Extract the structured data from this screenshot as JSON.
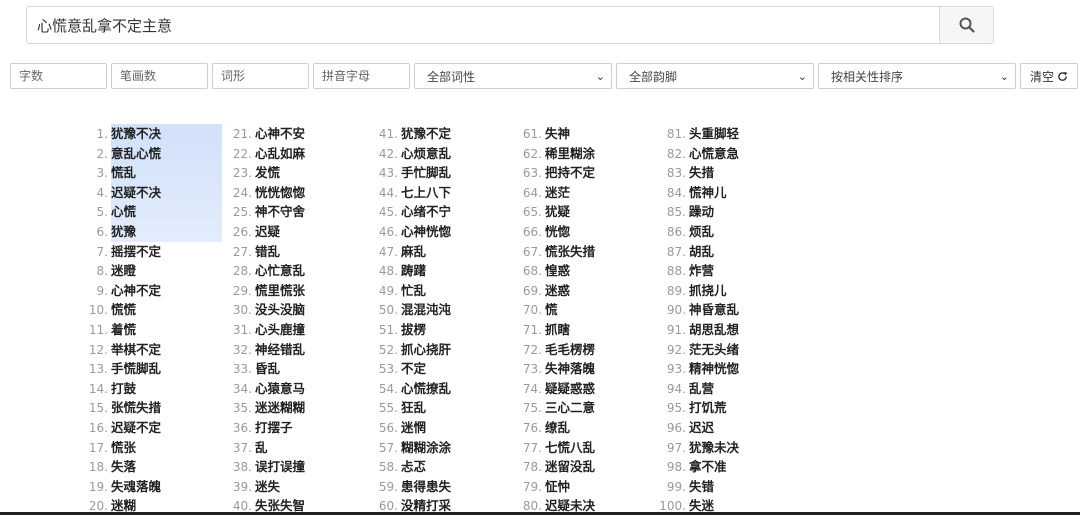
{
  "search": {
    "value": "心慌意乱拿不定主意"
  },
  "filters": {
    "char_count_placeholder": "字数",
    "stroke_count_placeholder": "笔画数",
    "word_form_placeholder": "词形",
    "pinyin_placeholder": "拼音字母",
    "part_of_speech": "全部词性",
    "rhyme": "全部韵脚",
    "sort": "按相关性排序",
    "clear_label": "清空"
  },
  "results": [
    {
      "n": "1.",
      "w": "犹豫不决"
    },
    {
      "n": "2.",
      "w": "意乱心慌"
    },
    {
      "n": "3.",
      "w": "慌乱"
    },
    {
      "n": "4.",
      "w": "迟疑不决"
    },
    {
      "n": "5.",
      "w": "心慌"
    },
    {
      "n": "6.",
      "w": "犹豫"
    },
    {
      "n": "7.",
      "w": "摇摆不定"
    },
    {
      "n": "8.",
      "w": "迷瞪"
    },
    {
      "n": "9.",
      "w": "心神不定"
    },
    {
      "n": "10.",
      "w": "慌慌"
    },
    {
      "n": "11.",
      "w": "着慌"
    },
    {
      "n": "12.",
      "w": "举棋不定"
    },
    {
      "n": "13.",
      "w": "手慌脚乱"
    },
    {
      "n": "14.",
      "w": "打鼓"
    },
    {
      "n": "15.",
      "w": "张慌失措"
    },
    {
      "n": "16.",
      "w": "迟疑不定"
    },
    {
      "n": "17.",
      "w": "慌张"
    },
    {
      "n": "18.",
      "w": "失落"
    },
    {
      "n": "19.",
      "w": "失魂落魄"
    },
    {
      "n": "20.",
      "w": "迷糊"
    },
    {
      "n": "21.",
      "w": "心神不安"
    },
    {
      "n": "22.",
      "w": "心乱如麻"
    },
    {
      "n": "23.",
      "w": "发慌"
    },
    {
      "n": "24.",
      "w": "恍恍惚惚"
    },
    {
      "n": "25.",
      "w": "神不守舍"
    },
    {
      "n": "26.",
      "w": "迟疑"
    },
    {
      "n": "27.",
      "w": "错乱"
    },
    {
      "n": "28.",
      "w": "心忙意乱"
    },
    {
      "n": "29.",
      "w": "慌里慌张"
    },
    {
      "n": "30.",
      "w": "没头没脑"
    },
    {
      "n": "31.",
      "w": "心头鹿撞"
    },
    {
      "n": "32.",
      "w": "神经错乱"
    },
    {
      "n": "33.",
      "w": "昏乱"
    },
    {
      "n": "34.",
      "w": "心猿意马"
    },
    {
      "n": "35.",
      "w": "迷迷糊糊"
    },
    {
      "n": "36.",
      "w": "打摆子"
    },
    {
      "n": "37.",
      "w": "乱"
    },
    {
      "n": "38.",
      "w": "误打误撞"
    },
    {
      "n": "39.",
      "w": "迷失"
    },
    {
      "n": "40.",
      "w": "失张失智"
    },
    {
      "n": "41.",
      "w": "犹豫不定"
    },
    {
      "n": "42.",
      "w": "心烦意乱"
    },
    {
      "n": "43.",
      "w": "手忙脚乱"
    },
    {
      "n": "44.",
      "w": "七上八下"
    },
    {
      "n": "45.",
      "w": "心绪不宁"
    },
    {
      "n": "46.",
      "w": "心神恍惚"
    },
    {
      "n": "47.",
      "w": "麻乱"
    },
    {
      "n": "48.",
      "w": "踌躇"
    },
    {
      "n": "49.",
      "w": "忙乱"
    },
    {
      "n": "50.",
      "w": "混混沌沌"
    },
    {
      "n": "51.",
      "w": "拔楞"
    },
    {
      "n": "52.",
      "w": "抓心挠肝"
    },
    {
      "n": "53.",
      "w": "不定"
    },
    {
      "n": "54.",
      "w": "心慌撩乱"
    },
    {
      "n": "55.",
      "w": "狂乱"
    },
    {
      "n": "56.",
      "w": "迷惘"
    },
    {
      "n": "57.",
      "w": "糊糊涂涂"
    },
    {
      "n": "58.",
      "w": "忐忑"
    },
    {
      "n": "59.",
      "w": "患得患失"
    },
    {
      "n": "60.",
      "w": "没精打采"
    },
    {
      "n": "61.",
      "w": "失神"
    },
    {
      "n": "62.",
      "w": "稀里糊涂"
    },
    {
      "n": "63.",
      "w": "把持不定"
    },
    {
      "n": "64.",
      "w": "迷茫"
    },
    {
      "n": "65.",
      "w": "犹疑"
    },
    {
      "n": "66.",
      "w": "恍惚"
    },
    {
      "n": "67.",
      "w": "慌张失措"
    },
    {
      "n": "68.",
      "w": "惶惑"
    },
    {
      "n": "69.",
      "w": "迷惑"
    },
    {
      "n": "70.",
      "w": "慌"
    },
    {
      "n": "71.",
      "w": "抓瞎"
    },
    {
      "n": "72.",
      "w": "毛毛楞楞"
    },
    {
      "n": "73.",
      "w": "失神落魄"
    },
    {
      "n": "74.",
      "w": "疑疑惑惑"
    },
    {
      "n": "75.",
      "w": "三心二意"
    },
    {
      "n": "76.",
      "w": "缭乱"
    },
    {
      "n": "77.",
      "w": "七慌八乱"
    },
    {
      "n": "78.",
      "w": "迷留没乱"
    },
    {
      "n": "79.",
      "w": "怔忡"
    },
    {
      "n": "80.",
      "w": "迟疑未决"
    },
    {
      "n": "81.",
      "w": "头重脚轻"
    },
    {
      "n": "82.",
      "w": "心慌意急"
    },
    {
      "n": "83.",
      "w": "失措"
    },
    {
      "n": "84.",
      "w": "慌神儿"
    },
    {
      "n": "85.",
      "w": "躁动"
    },
    {
      "n": "86.",
      "w": "烦乱"
    },
    {
      "n": "87.",
      "w": "胡乱"
    },
    {
      "n": "88.",
      "w": "炸营"
    },
    {
      "n": "89.",
      "w": "抓挠儿"
    },
    {
      "n": "90.",
      "w": "神昏意乱"
    },
    {
      "n": "91.",
      "w": "胡思乱想"
    },
    {
      "n": "92.",
      "w": "茫无头绪"
    },
    {
      "n": "93.",
      "w": "精神恍惚"
    },
    {
      "n": "94.",
      "w": "乱营"
    },
    {
      "n": "95.",
      "w": "打饥荒"
    },
    {
      "n": "96.",
      "w": "迟迟"
    },
    {
      "n": "97.",
      "w": "犹豫未决"
    },
    {
      "n": "98.",
      "w": "拿不准"
    },
    {
      "n": "99.",
      "w": "失错"
    },
    {
      "n": "100.",
      "w": "失迷"
    }
  ]
}
